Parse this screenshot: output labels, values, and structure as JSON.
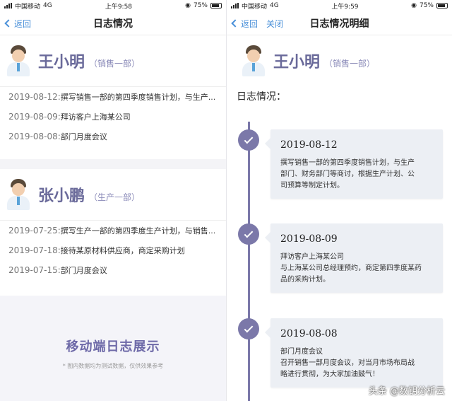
{
  "left": {
    "status": {
      "carrier": "中国移动",
      "network": "4G",
      "time": "上午9:58",
      "battery": "75%"
    },
    "nav": {
      "back": "返回",
      "title": "日志情况"
    },
    "people": [
      {
        "name": "王小明",
        "dept": "（销售一部）",
        "logs": [
          {
            "date": "2019-08-12:",
            "text": "撰写销售一部的第四季度销售计划，与生产..."
          },
          {
            "date": "2019-08-09:",
            "text": "拜访客户上海某公司"
          },
          {
            "date": "2019-08-08:",
            "text": "部门月度会议"
          }
        ]
      },
      {
        "name": "张小鹏",
        "dept": "（生产一部）",
        "logs": [
          {
            "date": "2019-07-25:",
            "text": "撰写生产一部的第四季度生产计划，与销售..."
          },
          {
            "date": "2019-07-18:",
            "text": "接待某原材料供应商，商定采购计划"
          },
          {
            "date": "2019-07-15:",
            "text": "部门月度会议"
          }
        ]
      }
    ],
    "banner": {
      "title": "移动端日志展示",
      "note": "* 图内数据均为测试数据，仅供效果参考"
    }
  },
  "right": {
    "status": {
      "carrier": "中国移动",
      "network": "4G",
      "time": "上午9:59",
      "battery": "75%"
    },
    "nav": {
      "back": "返回",
      "close": "关闭",
      "title": "日志情况明细"
    },
    "person": {
      "name": "王小明",
      "dept": "（销售一部）"
    },
    "logs_label": "日志情况：",
    "entries": [
      {
        "date": "2019-08-12",
        "lines": [
          "撰写销售一部的第四季度销售计划，与生产",
          "部门、财务部门等商讨，根据生产计划、公",
          "司预算等制定计划。"
        ]
      },
      {
        "date": "2019-08-09",
        "lines": [
          "拜访客户上海某公司",
          "与上海某公司总经理预约，商定第四季度某药",
          "品的采购计划。"
        ]
      },
      {
        "date": "2019-08-08",
        "lines": [
          "部门月度会议",
          "召开销售一部月度会议，对当月市场布局战",
          "略进行贯彻，为大家加油鼓气！"
        ]
      }
    ]
  },
  "watermark": "头条 @数钥分析云",
  "colors": {
    "accent": "#7b78a9",
    "link": "#4a90d9"
  }
}
